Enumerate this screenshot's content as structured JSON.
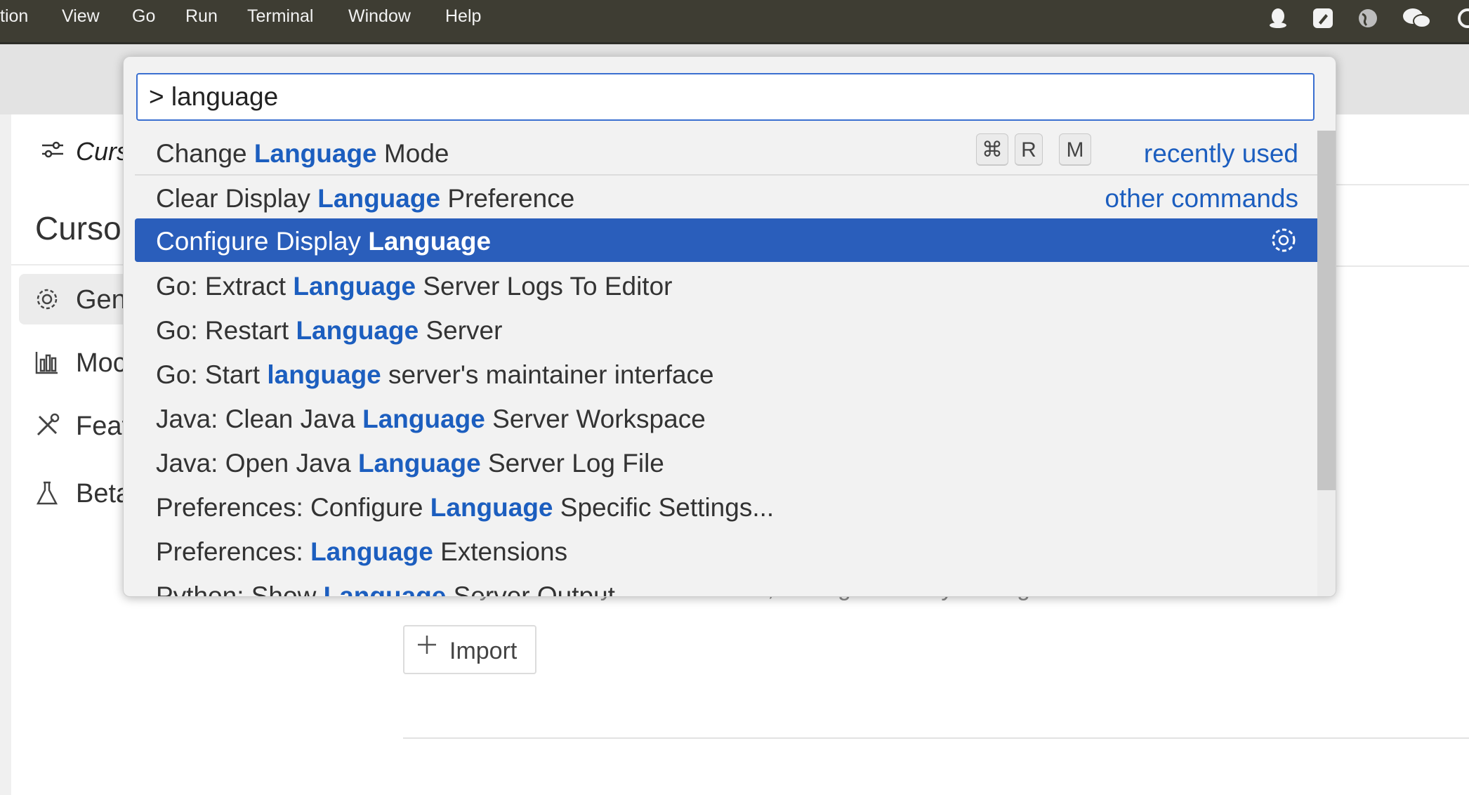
{
  "menubar": {
    "items": [
      "tion",
      "View",
      "Go",
      "Run",
      "Terminal",
      "Window",
      "Help"
    ]
  },
  "tray_icons": [
    "qq-penguin-icon",
    "app-logo-icon",
    "globe-icon",
    "wechat-icon",
    "overflow-icon"
  ],
  "settings": {
    "tab_title": "Curs",
    "heading": "Curso",
    "nav_items": [
      {
        "label": "Gen",
        "icon": "gear-icon",
        "active": true
      },
      {
        "label": "Moc",
        "icon": "chart-icon",
        "active": false
      },
      {
        "label": "Feat",
        "icon": "tools-icon",
        "active": false
      },
      {
        "label": "Beta",
        "icon": "flask-icon",
        "active": false
      }
    ],
    "content": {
      "description_fragment": "instantly use all of your extensions, settings and keybindings",
      "import_button": "Import"
    }
  },
  "palette": {
    "query": "> language",
    "items": [
      {
        "before": "Change ",
        "match": "Language",
        "after": " Mode",
        "keybinding": [
          "⌘",
          "R",
          "M"
        ],
        "group": "recently used"
      },
      {
        "before": "Clear Display ",
        "match": "Language",
        "after": " Preference",
        "group": "other commands"
      },
      {
        "before": "Configure Display ",
        "match": "Language",
        "after": "",
        "selected": true,
        "action_icon": "gear-icon"
      },
      {
        "before": "Go: Extract ",
        "match": "Language",
        "after": " Server Logs To Editor"
      },
      {
        "before": "Go: Restart ",
        "match": "Language",
        "after": " Server"
      },
      {
        "before": "Go: Start ",
        "match": "language",
        "after": " server's maintainer interface"
      },
      {
        "before": "Java: Clean Java ",
        "match": "Language",
        "after": " Server Workspace"
      },
      {
        "before": "Java: Open Java ",
        "match": "Language",
        "after": " Server Log File"
      },
      {
        "before": "Preferences: Configure ",
        "match": "Language",
        "after": " Specific Settings..."
      },
      {
        "before": "Preferences: ",
        "match": "Language",
        "after": " Extensions"
      },
      {
        "before": "Python: Show ",
        "match": "Language",
        "after": " Server Output"
      }
    ]
  },
  "colors": {
    "menubar_bg": "#3e3d33",
    "selection_bg": "#2a5ebb",
    "match_highlight": "#1c5ebf",
    "focus_border": "#3a6fd0"
  }
}
